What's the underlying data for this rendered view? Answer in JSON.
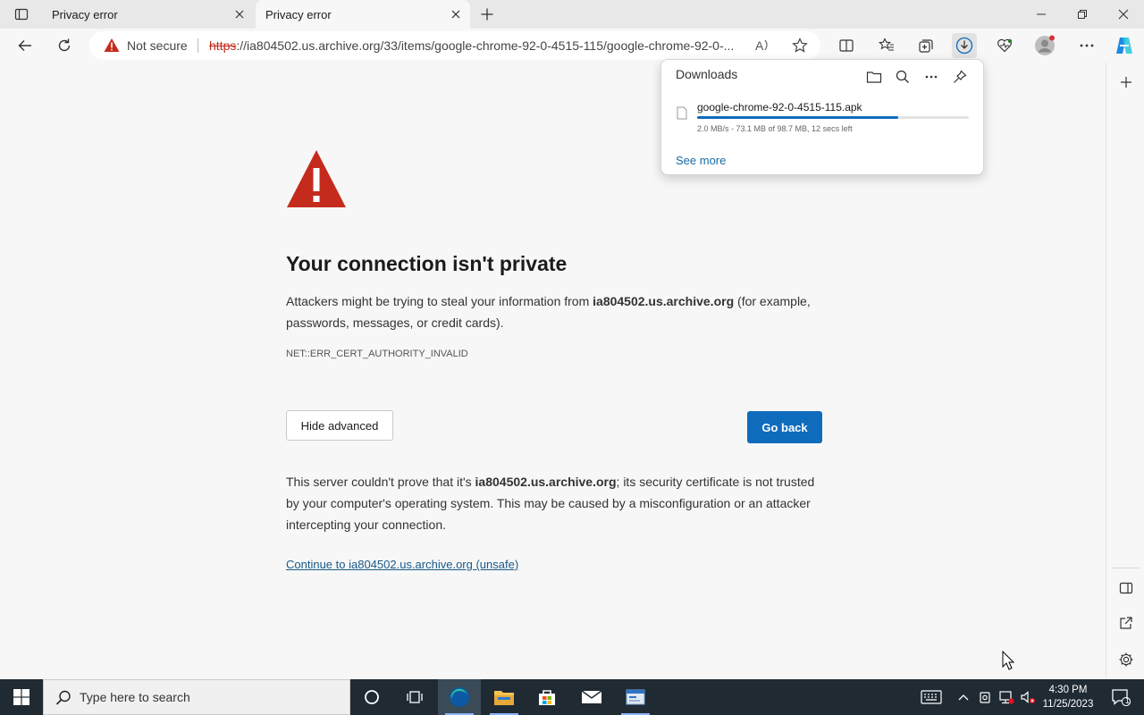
{
  "tabs": [
    {
      "title": "Privacy error",
      "active": false
    },
    {
      "title": "Privacy error",
      "active": true
    }
  ],
  "toolbar": {
    "security_label": "Not secure",
    "url_scheme": "https",
    "url_rest": "://ia804502.us.archive.org/33/items/google-chrome-92-0-4515-115/google-chrome-92-0-..."
  },
  "downloads": {
    "title": "Downloads",
    "item": {
      "filename": "google-chrome-92-0-4515-115.apk",
      "status": "2.0 MB/s - 73.1 MB of 98.7 MB, 12 secs left",
      "progress_fraction": 0.74
    },
    "see_more": "See more"
  },
  "error_page": {
    "title": "Your connection isn't private",
    "intro_prefix": "Attackers might be trying to steal your information from ",
    "host": "ia804502.us.archive.org",
    "intro_suffix": " (for example, passwords, messages, or credit cards).",
    "error_code": "NET::ERR_CERT_AUTHORITY_INVALID",
    "hide_advanced_label": "Hide advanced",
    "go_back_label": "Go back",
    "advanced_prefix": "This server couldn't prove that it's ",
    "advanced_suffix": "; its security certificate is not trusted by your computer's operating system. This may be caused by a misconfiguration or an attacker intercepting your connection.",
    "continue_link": "Continue to ia804502.us.archive.org (unsafe)"
  },
  "taskbar": {
    "search_placeholder": "Type here to search",
    "time": "4:30 PM",
    "date": "11/25/2023",
    "notification_count": "1"
  },
  "colors": {
    "accent": "#0f6cbd",
    "warning": "#c42b1c",
    "taskbar": "#1f2a33"
  }
}
